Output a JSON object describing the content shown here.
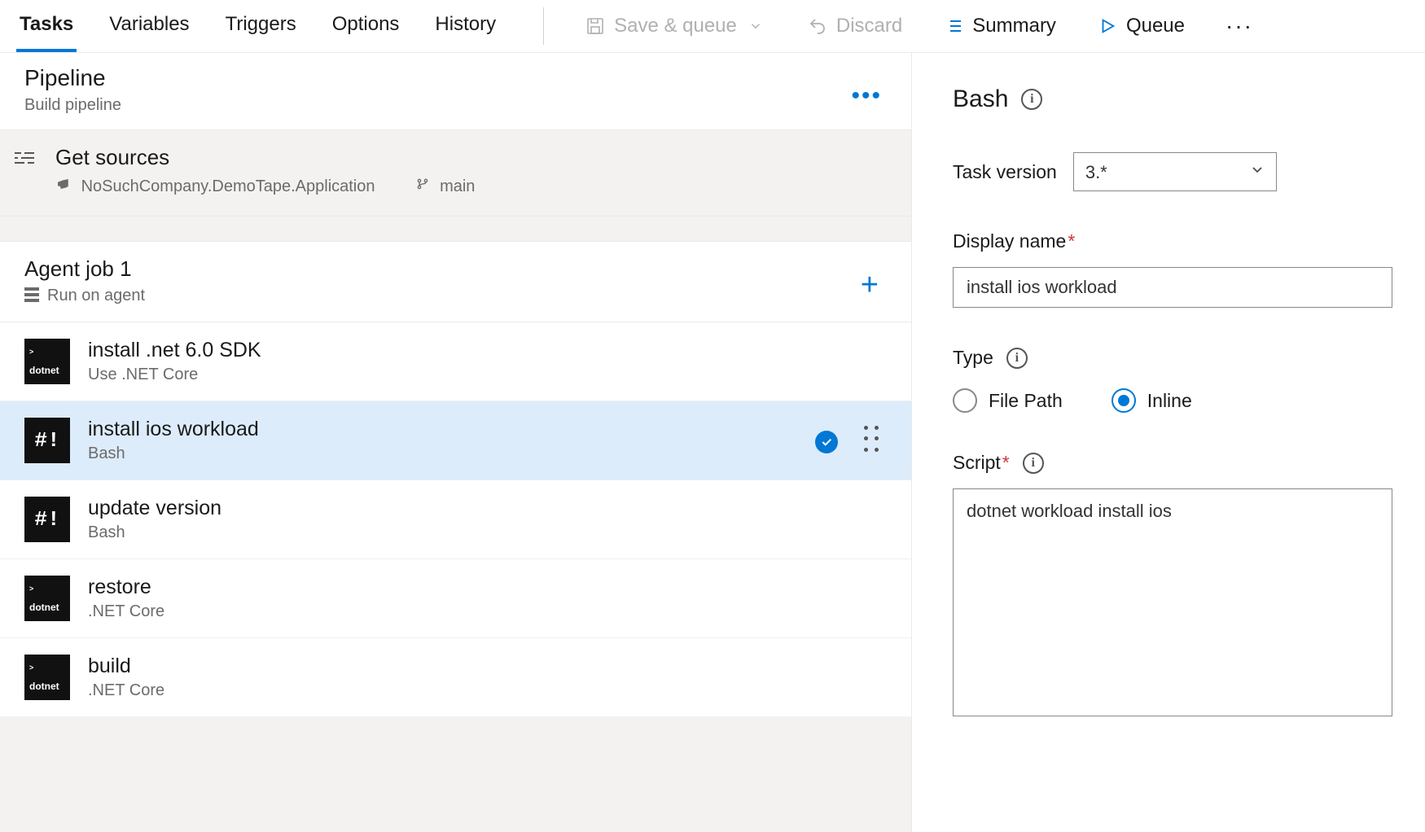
{
  "tabs": {
    "tasks": "Tasks",
    "variables": "Variables",
    "triggers": "Triggers",
    "options": "Options",
    "history": "History"
  },
  "toolbar": {
    "save_queue": "Save & queue",
    "discard": "Discard",
    "summary": "Summary",
    "queue": "Queue"
  },
  "pipeline": {
    "title": "Pipeline",
    "subtitle": "Build pipeline"
  },
  "sources": {
    "title": "Get sources",
    "repo": "NoSuchCompany.DemoTape.Application",
    "branch": "main"
  },
  "job": {
    "title": "Agent job 1",
    "subtitle": "Run on agent"
  },
  "steps": [
    {
      "name": "install .net 6.0 SDK",
      "task": "Use .NET Core",
      "icon": "dotnet",
      "selected": false
    },
    {
      "name": "install ios workload",
      "task": "Bash",
      "icon": "bash",
      "selected": true
    },
    {
      "name": "update version",
      "task": "Bash",
      "icon": "bash",
      "selected": false
    },
    {
      "name": "restore",
      "task": ".NET Core",
      "icon": "dotnet",
      "selected": false
    },
    {
      "name": "build",
      "task": ".NET Core",
      "icon": "dotnet",
      "selected": false
    }
  ],
  "details": {
    "heading": "Bash",
    "task_version_label": "Task version",
    "task_version_value": "3.*",
    "display_name_label": "Display name",
    "display_name_value": "install ios workload",
    "type_label": "Type",
    "type_options": {
      "file_path": "File Path",
      "inline": "Inline"
    },
    "type_selected": "inline",
    "script_label": "Script",
    "script_value": "dotnet workload install ios"
  }
}
